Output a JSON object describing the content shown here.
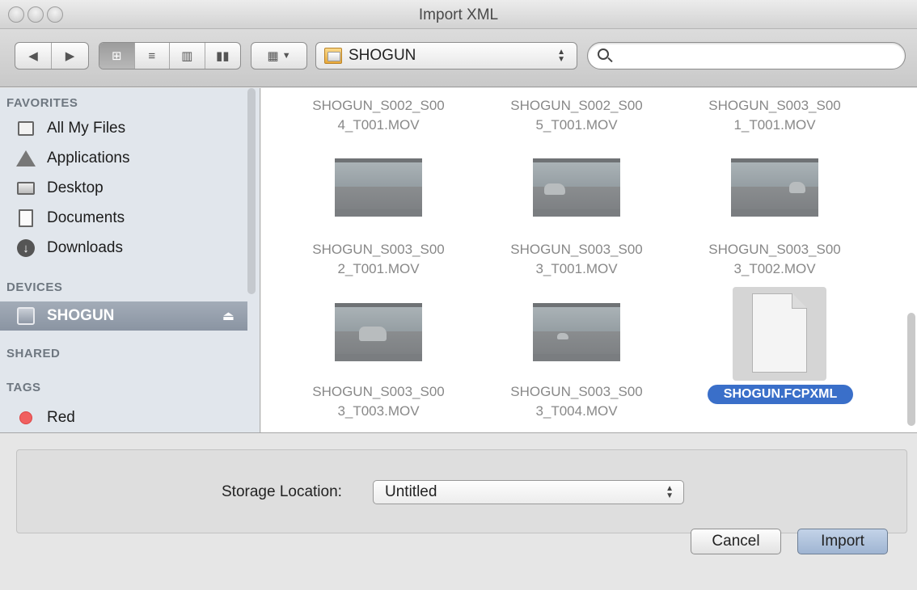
{
  "window": {
    "title": "Import XML"
  },
  "toolbar": {
    "location": "SHOGUN",
    "search": {
      "value": "",
      "placeholder": ""
    }
  },
  "sidebar": {
    "sections": {
      "favorites": "FAVORITES",
      "devices": "DEVICES",
      "shared": "SHARED",
      "tags": "TAGS"
    },
    "favorites": [
      {
        "label": "All My Files",
        "icon": "all-my-files-icon"
      },
      {
        "label": "Applications",
        "icon": "applications-icon"
      },
      {
        "label": "Desktop",
        "icon": "desktop-icon"
      },
      {
        "label": "Documents",
        "icon": "documents-icon"
      },
      {
        "label": "Downloads",
        "icon": "downloads-icon"
      }
    ],
    "devices": [
      {
        "label": "SHOGUN",
        "icon": "drive-icon",
        "selected": true
      }
    ],
    "tags": [
      {
        "label": "Red",
        "color": "#f06060"
      }
    ]
  },
  "files": [
    {
      "line1": "SHOGUN_S002_S00",
      "line2": "4_T001.MOV"
    },
    {
      "line1": "SHOGUN_S002_S00",
      "line2": "5_T001.MOV"
    },
    {
      "line1": "SHOGUN_S003_S00",
      "line2": "1_T001.MOV"
    },
    {
      "line1": "SHOGUN_S003_S00",
      "line2": "2_T001.MOV"
    },
    {
      "line1": "SHOGUN_S003_S00",
      "line2": "3_T001.MOV"
    },
    {
      "line1": "SHOGUN_S003_S00",
      "line2": "3_T002.MOV"
    },
    {
      "line1": "SHOGUN_S003_S00",
      "line2": "3_T003.MOV"
    },
    {
      "line1": "SHOGUN_S003_S00",
      "line2": "3_T004.MOV"
    }
  ],
  "selected_file": "SHOGUN.FCPXML",
  "accessory": {
    "storage_label": "Storage Location:",
    "storage_value": "Untitled"
  },
  "buttons": {
    "cancel": "Cancel",
    "import": "Import"
  },
  "colors": {
    "selection": "#3a6fc9",
    "sidebar_bg": "#e1e6ec"
  }
}
